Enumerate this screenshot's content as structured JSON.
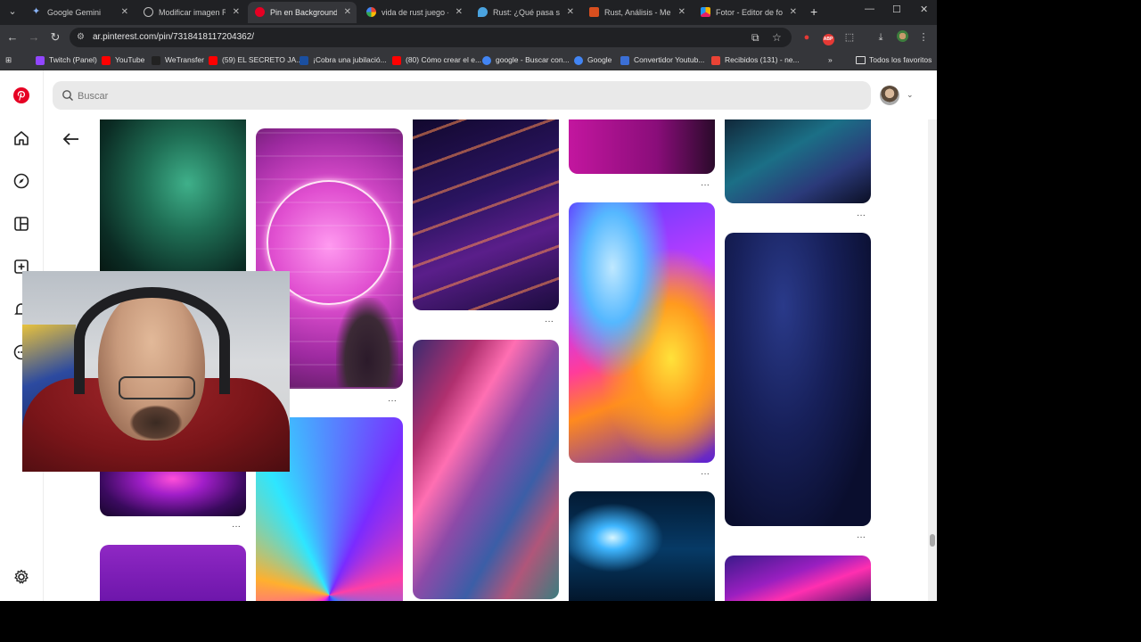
{
  "tabs": [
    {
      "title": "Google Gemini",
      "fav_color": "#8ab4f8",
      "active": false
    },
    {
      "title": "Modificar imagen Rust",
      "fav_color": "#bdbdbd",
      "active": false
    },
    {
      "title": "Pin en Backgrounds/W",
      "fav_color": "#e60023",
      "active": true
    },
    {
      "title": "vida de rust juego - B",
      "fav_color": "#4285f4",
      "active": false
    },
    {
      "title": "Rust: ¿Qué pasa si m",
      "fav_color": "#4aa3df",
      "active": false
    },
    {
      "title": "Rust, Análisis - Merist",
      "fav_color": "#d94f1f",
      "active": false
    },
    {
      "title": "Fotor - Editor de foto",
      "fav_color": "#f4b400",
      "active": false
    }
  ],
  "address_bar": {
    "url": "ar.pinterest.com/pin/7318418117204362/"
  },
  "bookmarks": [
    {
      "label": "Twitch (Panel)",
      "color": "#9146ff"
    },
    {
      "label": "YouTube",
      "color": "#ff0000"
    },
    {
      "label": "WeTransfer",
      "color": "#222222"
    },
    {
      "label": "(59) EL SECRETO JA...",
      "color": "#ff0000"
    },
    {
      "label": "¡Cobra una jubilació...",
      "color": "#1a4fa0"
    },
    {
      "label": "(80) Cómo crear el e...",
      "color": "#ff0000"
    },
    {
      "label": "google - Buscar con...",
      "color": "#4285f4"
    },
    {
      "label": "Google",
      "color": "#4285f4"
    },
    {
      "label": "Convertidor Youtub...",
      "color": "#3b6fd6"
    },
    {
      "label": "Recibidos (131) - ne...",
      "color": "#ea4335"
    }
  ],
  "all_bookmarks_label": "Todos los favoritos",
  "search": {
    "placeholder": "Buscar"
  },
  "pin_menu": "···",
  "colors": {
    "pinterest_red": "#e60023",
    "search_bg": "#e9e9e9"
  }
}
